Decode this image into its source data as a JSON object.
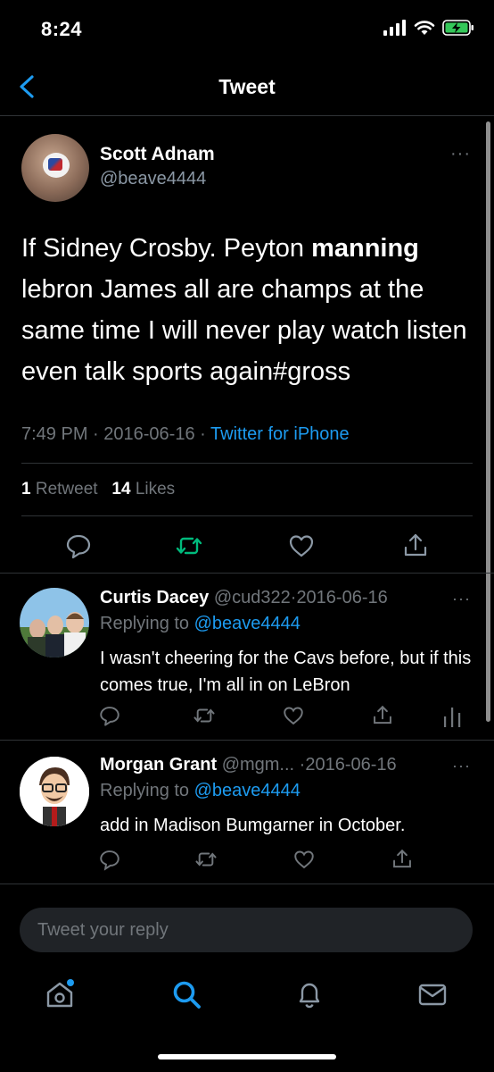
{
  "status_bar": {
    "time": "8:24"
  },
  "nav": {
    "title": "Tweet"
  },
  "main_tweet": {
    "name": "Scott Adnam",
    "handle": "@beave4444",
    "text_before": "If Sidney Crosby. Peyton ",
    "text_bold": "manning",
    "text_after": " lebron James all are champs at the same time  I will never play watch listen even talk sports again#gross",
    "time": "7:49 PM",
    "date": "2016-06-16",
    "source": "Twitter for iPhone",
    "retweet_count": "1",
    "retweet_label": "Retweet",
    "like_count": "14",
    "like_label": "Likes"
  },
  "replies": [
    {
      "name": "Curtis Dacey",
      "handle": "@cud322",
      "date": "2016-06-16",
      "replying_prefix": "Replying to",
      "replying_to": "@beave4444",
      "text": "I wasn't cheering for the Cavs before, but if this comes true, I'm all in on LeBron"
    },
    {
      "name": "Morgan Grant",
      "handle": "@mgm...",
      "date": "2016-06-16",
      "replying_prefix": "Replying to",
      "replying_to": "@beave4444",
      "text": "add in Madison Bumgarner in October."
    }
  ],
  "reply_box": {
    "placeholder": "Tweet your reply"
  },
  "separator": "·",
  "more_glyph": "···",
  "colors": {
    "accent": "#1d9bf0",
    "retweet_green": "#00ba7c",
    "muted": "#71767b",
    "background": "#000000"
  },
  "icons": {
    "status": [
      "signal-icon",
      "wifi-icon",
      "battery-charging-icon"
    ],
    "tweet_actions": [
      "reply-icon",
      "retweet-icon",
      "like-icon",
      "share-icon",
      "analytics-icon"
    ],
    "tab_bar": [
      "home-icon",
      "search-icon",
      "notifications-icon",
      "messages-icon"
    ]
  }
}
